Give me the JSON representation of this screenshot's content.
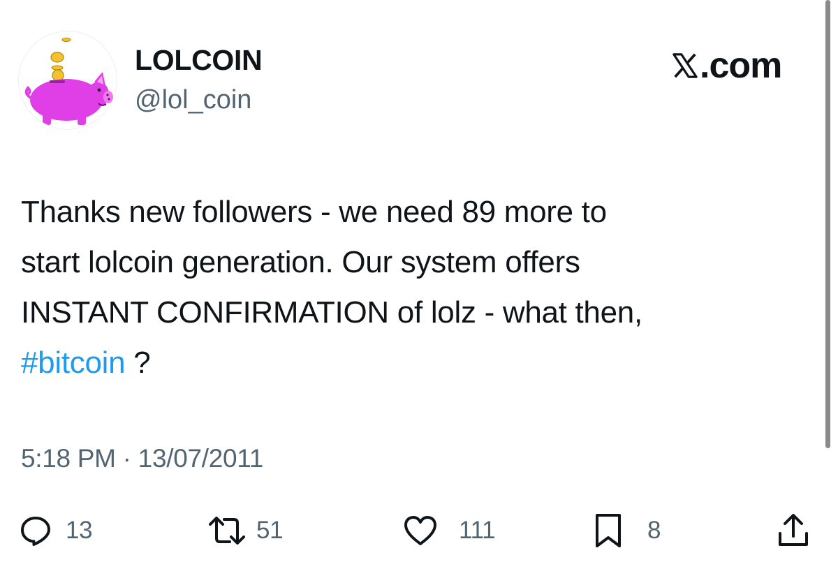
{
  "author": {
    "display_name": "LOLCOIN",
    "handle": "@lol_coin"
  },
  "brand": {
    "label": ".com"
  },
  "tweet": {
    "lines": [
      "Thanks new followers - we need 89 more to",
      "start lolcoin generation. Our system offers",
      "INSTANT CONFIRMATION of lolz - what then,"
    ],
    "hashtag": "#bitcoin",
    "trailing": " ?",
    "timestamp": "5:18 PM · 13/07/2011"
  },
  "actions": {
    "replies": "13",
    "reposts": "51",
    "likes": "111",
    "bookmarks": "8"
  },
  "icons": {
    "reply": "reply-icon",
    "repost": "repost-icon",
    "like": "heart-icon",
    "bookmark": "bookmark-icon",
    "share": "share-icon",
    "brand": "x-logo-icon"
  },
  "colors": {
    "text": "#0f1419",
    "secondary": "#536471",
    "hashtag": "#1d9bf0",
    "pig": "#e03ee6"
  }
}
